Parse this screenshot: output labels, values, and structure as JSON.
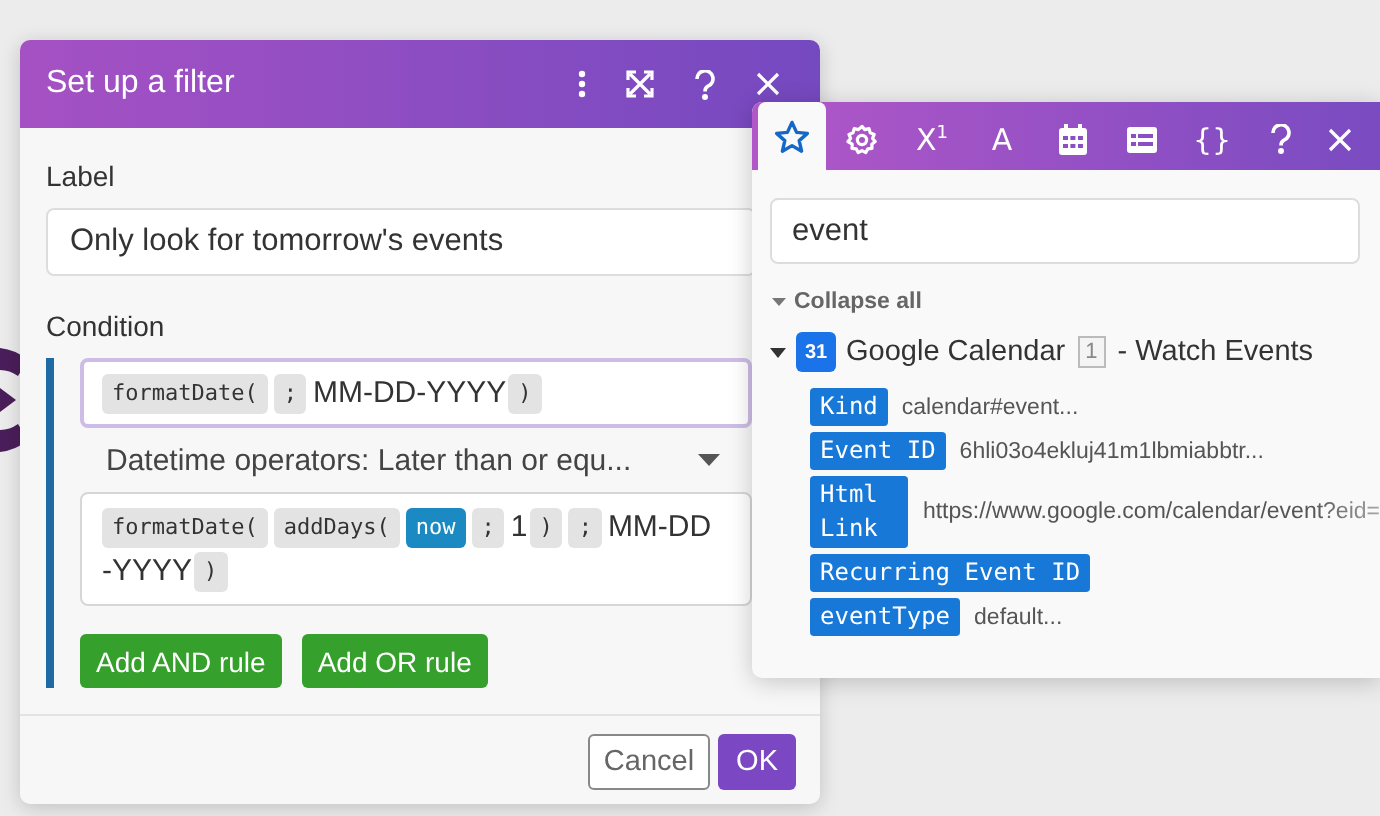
{
  "dialog": {
    "title": "Set up a filter",
    "header_buttons": [
      {
        "kind": "more"
      },
      {
        "kind": "expand"
      },
      {
        "kind": "help"
      },
      {
        "kind": "close"
      }
    ],
    "label_field": {
      "label": "Label",
      "value": "Only look for tomorrow's events"
    },
    "condition": {
      "label": "Condition",
      "operand_a": {
        "focused": true,
        "tokens": [
          {
            "kind": "function",
            "text": "formatDate("
          },
          {
            "kind": "separator",
            "text": ";"
          },
          {
            "kind": "text",
            "text": "MM-DD-YYYY"
          },
          {
            "kind": "separator",
            "text": ")"
          }
        ]
      },
      "operator": "Datetime operators: Later than or equ...",
      "operand_b": {
        "focused": false,
        "tokens": [
          {
            "kind": "function",
            "text": "formatDate("
          },
          {
            "kind": "function",
            "text": "addDays("
          },
          {
            "kind": "variable",
            "text": "now"
          },
          {
            "kind": "separator",
            "text": ";"
          },
          {
            "kind": "text",
            "text": "1"
          },
          {
            "kind": "separator",
            "text": ")"
          },
          {
            "kind": "separator",
            "text": ";"
          },
          {
            "kind": "text",
            "text": "MM-DD"
          },
          {
            "kind": "text",
            "text": "-YYYY"
          },
          {
            "kind": "separator",
            "text": ")"
          }
        ]
      },
      "rule_buttons": [
        "Add AND rule",
        "Add OR rule"
      ]
    },
    "footer_buttons": [
      {
        "kind": "secondary",
        "label": "Cancel"
      },
      {
        "kind": "primary",
        "label": "OK"
      }
    ]
  },
  "popover": {
    "tabs": [
      {
        "kind": "star",
        "selected": true
      },
      {
        "kind": "gear",
        "selected": false
      },
      {
        "kind": "glyph",
        "label": "X$^{1}$",
        "selected": false
      },
      {
        "kind": "glyph",
        "label": "A",
        "selected": false
      },
      {
        "kind": "calendar",
        "selected": false
      },
      {
        "kind": "table",
        "selected": false
      },
      {
        "kind": "glyph",
        "label": "{}",
        "selected": false
      }
    ],
    "header_buttons": [
      {
        "kind": "help"
      },
      {
        "kind": "close"
      }
    ],
    "search": {
      "value": "event"
    },
    "collapse_label": "Collapse all",
    "module": {
      "icon_text": "31",
      "name": "Google Calendar",
      "badge": "1",
      "action": "- Watch Events",
      "expanded": true,
      "items": [
        {
          "key": "Kind",
          "value": "calendar#event..."
        },
        {
          "key": "Event ID",
          "value": "6hli03o4ekluj41m1lbmiabbtr..."
        },
        {
          "key": "Html Link",
          "value": "https://www.google.com/calendar/event?eid="
        },
        {
          "key": "Recurring Event ID"
        },
        {
          "key": "eventType",
          "value": "default..."
        }
      ]
    }
  }
}
